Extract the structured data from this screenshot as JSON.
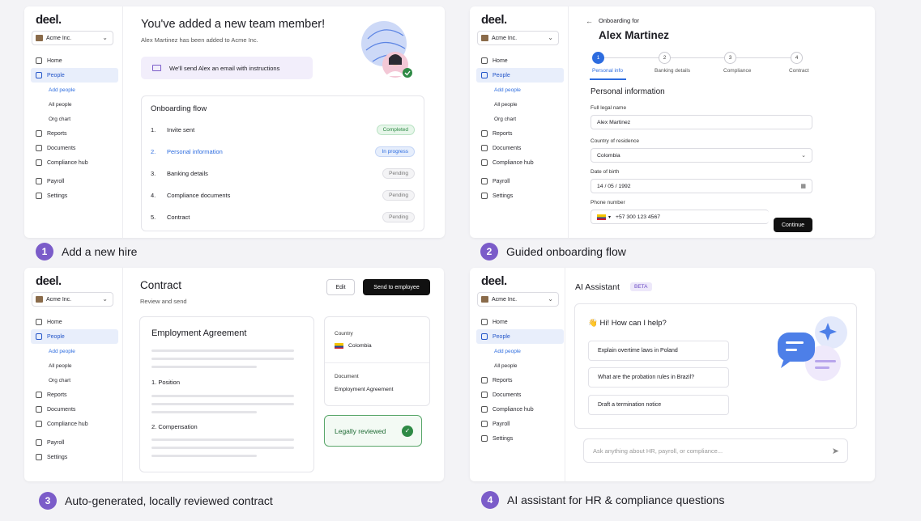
{
  "brand": {
    "logo": "deel.",
    "company": "Acme Inc.",
    "accent": "#2d6cdf",
    "purple": "#7b5cc9"
  },
  "nav": {
    "home": "Home",
    "people": "People",
    "add_people": "Add people",
    "all_people": "All people",
    "org_chart": "Org chart",
    "reports": "Reports",
    "documents": "Documents",
    "compliance_hub": "Compliance hub",
    "payroll": "Payroll",
    "settings": "Settings"
  },
  "captions": [
    {
      "num": "1",
      "text": "Add a new hire"
    },
    {
      "num": "2",
      "text": "Guided onboarding flow"
    },
    {
      "num": "3",
      "text": "Auto-generated, locally reviewed contract"
    },
    {
      "num": "4",
      "text": "AI assistant for HR & compliance questions"
    }
  ],
  "panel1": {
    "title": "You've added a new team member!",
    "subtitle": "Alex Martinez has been added to Acme Inc.",
    "email_note": "We'll send Alex an email with instructions",
    "flow_title": "Onboarding flow",
    "flow": [
      {
        "n": "1.",
        "label": "Invite sent",
        "status": "Completed"
      },
      {
        "n": "2.",
        "label": "Personal information",
        "status": "In progress"
      },
      {
        "n": "3.",
        "label": "Banking details",
        "status": "Pending"
      },
      {
        "n": "4.",
        "label": "Compliance documents",
        "status": "Pending"
      },
      {
        "n": "5.",
        "label": "Contract",
        "status": "Pending"
      }
    ]
  },
  "panel2": {
    "back": "←",
    "onboarding_for": "Onboarding for",
    "name": "Alex Martinez",
    "steps": [
      {
        "n": "1",
        "label": "Personal info"
      },
      {
        "n": "2",
        "label": "Banking details"
      },
      {
        "n": "3",
        "label": "Compliance"
      },
      {
        "n": "4",
        "label": "Contract"
      }
    ],
    "section_title": "Personal information",
    "fields": {
      "legal_name_label": "Full legal name",
      "legal_name_value": "Alex Martinez",
      "country_label": "Country of residence",
      "country_value": "Colombia",
      "dob_label": "Date of birth",
      "dob_value": "14  /  05  /  1992",
      "phone_label": "Phone number",
      "phone_value": "+57 300 123 4567"
    },
    "continue": "Continue"
  },
  "panel3": {
    "title": "Contract",
    "subtitle": "Review and send",
    "edit": "Edit",
    "send": "Send to employee",
    "doc_title": "Employment Agreement",
    "section1": "1. Position",
    "section2": "2. Compensation",
    "country_label": "Country",
    "country_value": "Colombia",
    "document_label": "Document",
    "document_value": "Employment Agreement",
    "reviewed": "Legally reviewed"
  },
  "panel4": {
    "title": "AI Assistant",
    "beta": "BETA",
    "greeting": "👋 Hi! How can I help?",
    "suggestions": [
      "Explain overtime laws in Poland",
      "What are the probation rules in Brazil?",
      "Draft a termination notice"
    ],
    "placeholder": "Ask anything about HR, payroll, or compliance..."
  }
}
